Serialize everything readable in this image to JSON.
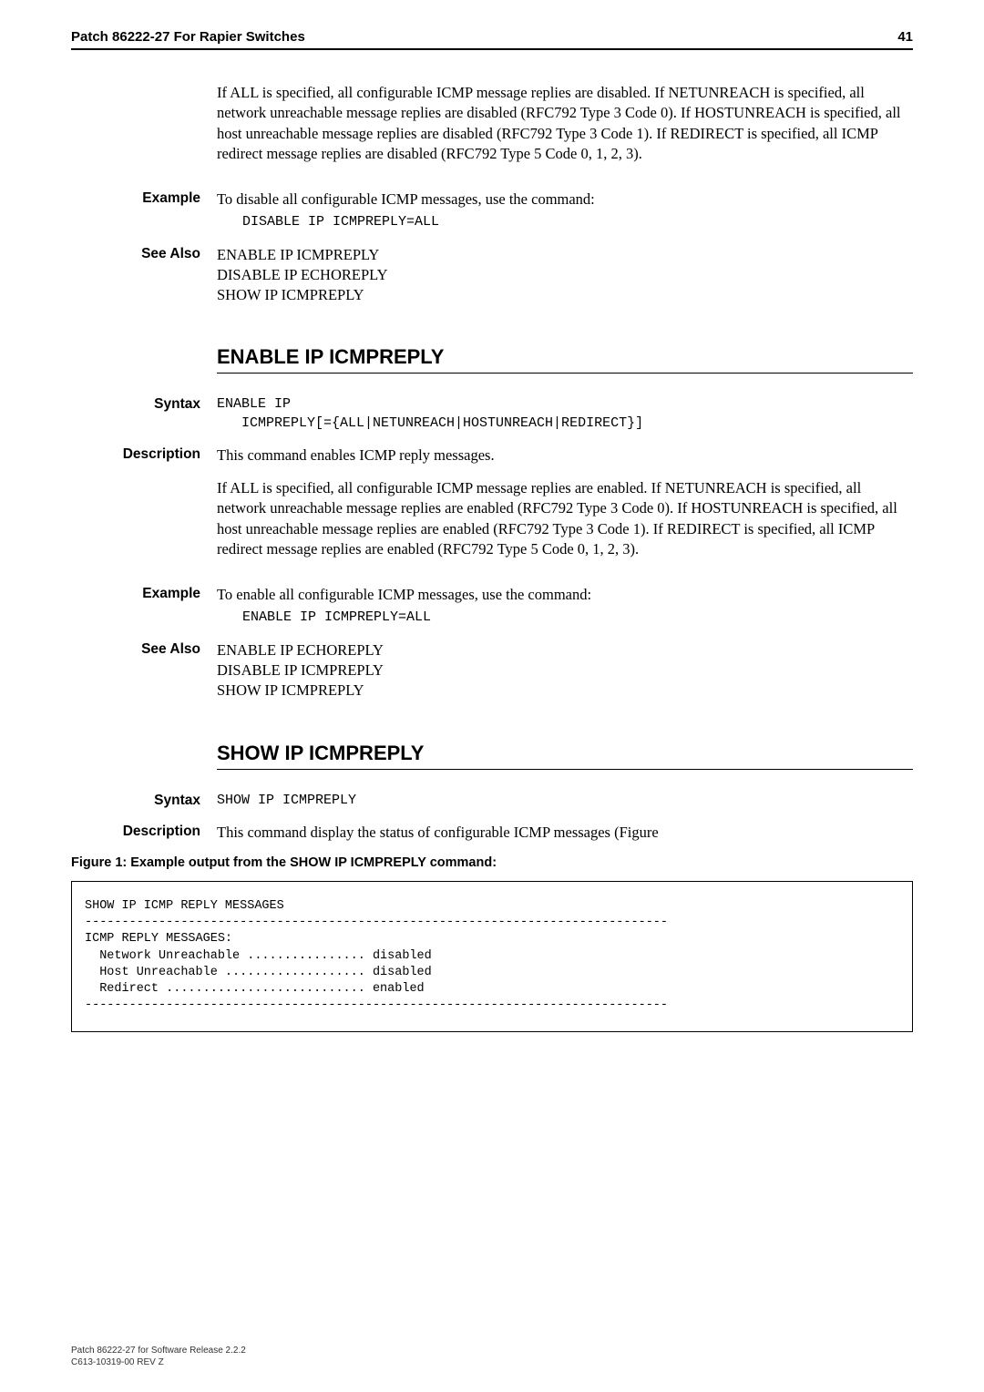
{
  "header": {
    "left": "Patch 86222-27 For Rapier Switches",
    "right": "41"
  },
  "intro_para": "If ALL is specified, all configurable ICMP message replies are disabled. If NETUNREACH is specified, all network unreachable message replies are disabled (RFC792 Type 3 Code 0). If HOSTUNREACH is specified, all host unreachable message replies are disabled (RFC792 Type 3 Code 1). If REDIRECT is specified, all ICMP redirect message replies are disabled (RFC792 Type 5 Code 0, 1, 2, 3).",
  "labels": {
    "example": "Example",
    "see_also": "See Also",
    "syntax": "Syntax",
    "description": "Description"
  },
  "disable_section": {
    "example_text": "To disable all configurable ICMP messages, use the command:",
    "example_cmd": "DISABLE IP ICMPREPLY=ALL",
    "see_also_1": "ENABLE IP ICMPREPLY",
    "see_also_2": "DISABLE IP ECHOREPLY",
    "see_also_3": "SHOW IP ICMPREPLY"
  },
  "enable_heading": "ENABLE IP ICMPREPLY",
  "enable_section": {
    "syntax_line1": "ENABLE IP",
    "syntax_line2": "   ICMPREPLY[={ALL|NETUNREACH|HOSTUNREACH|REDIRECT}]",
    "desc_line": "This command enables ICMP reply messages.",
    "desc_para": "If ALL is specified, all configurable ICMP message replies are enabled. If NETUNREACH is specified, all network unreachable message replies are enabled (RFC792 Type 3 Code 0). If HOSTUNREACH is specified, all host unreachable message replies are enabled (RFC792 Type 3 Code 1). If REDIRECT is specified, all ICMP redirect message replies are enabled (RFC792 Type 5 Code 0, 1, 2, 3).",
    "example_text": "To enable all configurable ICMP messages, use the command:",
    "example_cmd": "ENABLE IP ICMPREPLY=ALL",
    "see_also_1": "ENABLE IP ECHOREPLY",
    "see_also_2": "DISABLE IP ICMPREPLY",
    "see_also_3": "SHOW IP ICMPREPLY"
  },
  "show_heading": "SHOW IP ICMPREPLY",
  "show_section": {
    "syntax": "SHOW IP ICMPREPLY",
    "desc": "This command display the status of configurable ICMP messages (Figure"
  },
  "figure_caption": "Figure 1: Example output from the SHOW IP ICMPREPLY command:",
  "code_output": "SHOW IP ICMP REPLY MESSAGES\n-------------------------------------------------------------------------------\nICMP REPLY MESSAGES:\n  Network Unreachable ................ disabled\n  Host Unreachable ................... disabled\n  Redirect ........................... enabled\n-------------------------------------------------------------------------------",
  "footer_line1": "Patch 86222-27 for Software Release 2.2.2",
  "footer_line2": "C613-10319-00 REV Z"
}
